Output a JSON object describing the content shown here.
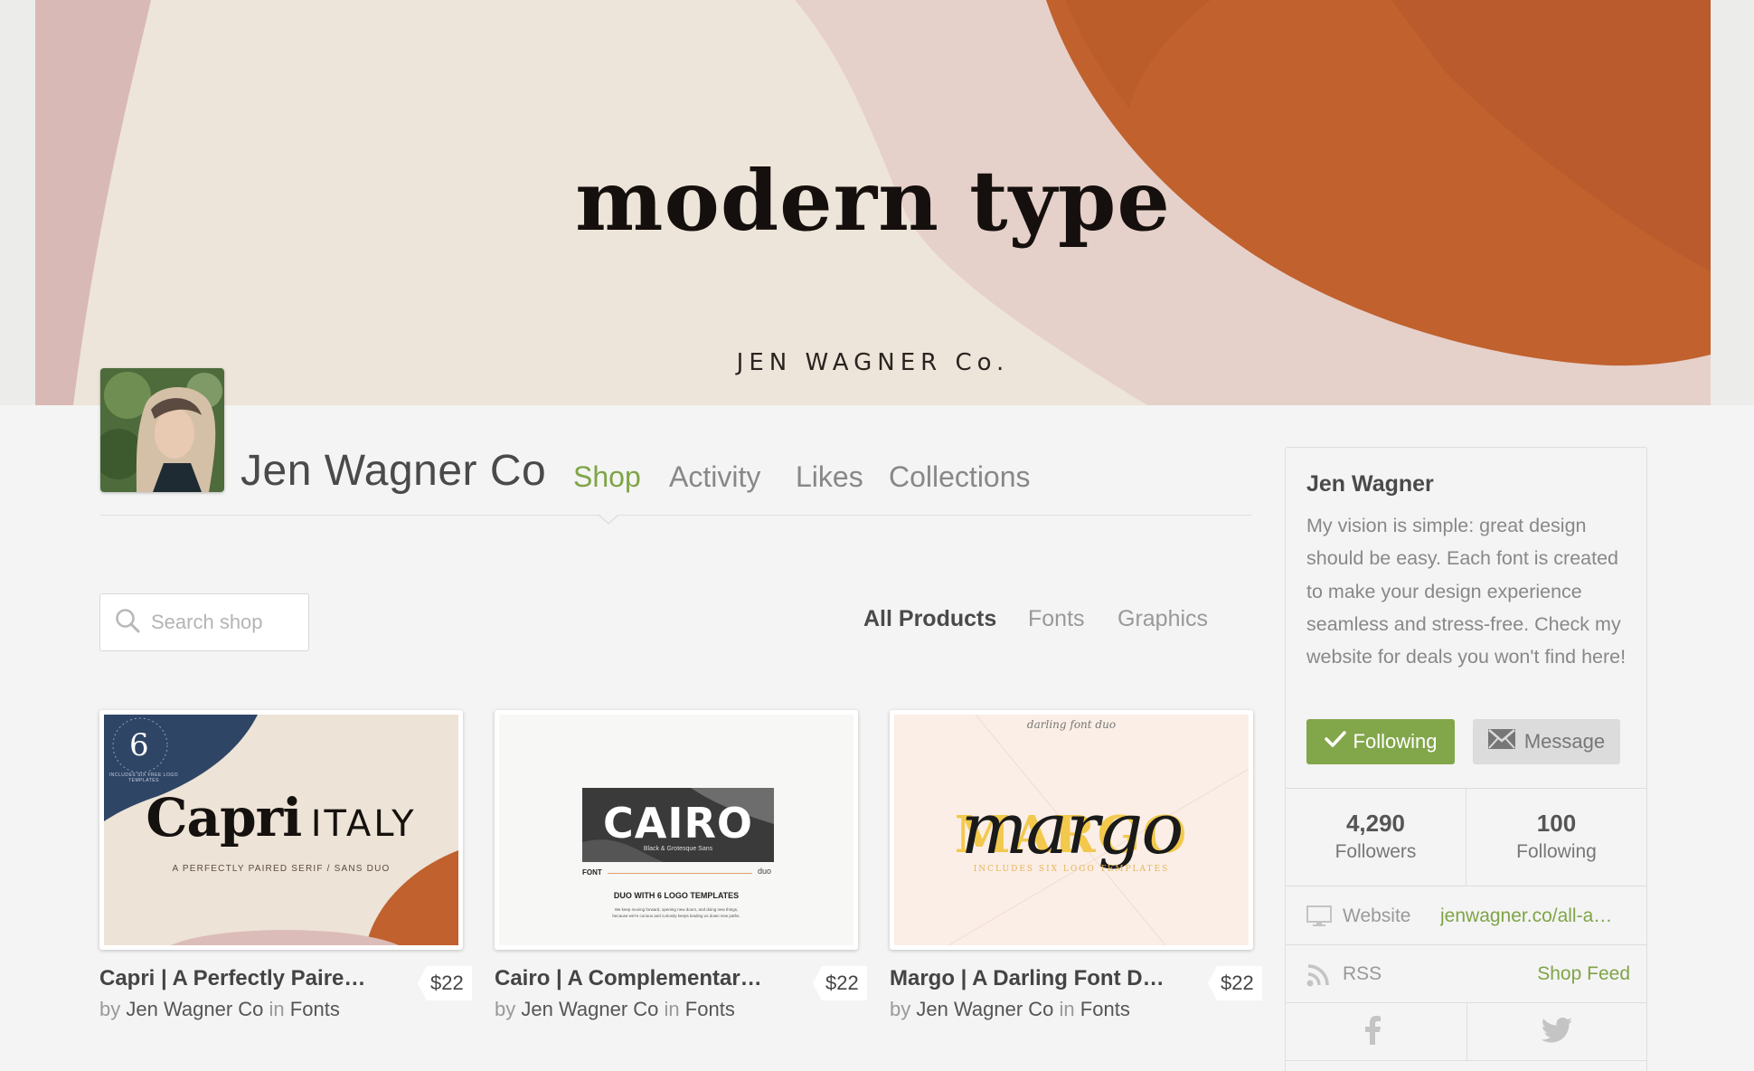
{
  "banner": {
    "title": "modern type",
    "subtitle": "JEN WAGNER Co."
  },
  "profile": {
    "shop_name": "Jen Wagner Co",
    "tabs": [
      {
        "label": "Shop",
        "active": true
      },
      {
        "label": "Activity",
        "active": false
      },
      {
        "label": "Likes",
        "active": false
      },
      {
        "label": "Collections",
        "active": false
      }
    ]
  },
  "search": {
    "placeholder": "Search shop",
    "icon": "search-icon"
  },
  "filters": [
    {
      "label": "All Products",
      "active": true
    },
    {
      "label": "Fonts",
      "active": false
    },
    {
      "label": "Graphics",
      "active": false
    }
  ],
  "products": [
    {
      "title": "Capri | A Perfectly Paire…",
      "price": "$22",
      "by_word": "by",
      "author": "Jen Wagner Co",
      "in_word": "in",
      "category": "Fonts",
      "thumb": {
        "badge_number": "6",
        "badge_ring": "INCLUDES SIX FREE LOGO TEMPLATES",
        "word": "Capri",
        "word2": "ITALY",
        "tagline": "A PERFECTLY PAIRED SERIF / SANS DUO"
      }
    },
    {
      "title": "Cairo | A Complementar…",
      "price": "$22",
      "by_word": "by",
      "author": "Jen Wagner Co",
      "in_word": "in",
      "category": "Fonts",
      "thumb": {
        "word": "CAIRO",
        "sub": "Black & Grotesque Sans",
        "left_tag": "FONT",
        "right_tag": "duo",
        "tagline": "DUO WITH 6 LOGO TEMPLATES",
        "fine1": "We keep moving forward, opening new doors, and doing new things,",
        "fine2": "because we're curious and curiosity keeps leading us down new paths."
      }
    },
    {
      "title": "Margo | A Darling Font D…",
      "price": "$22",
      "by_word": "by",
      "author": "Jen Wagner Co",
      "in_word": "in",
      "category": "Fonts",
      "thumb": {
        "script_top": "darling font duo",
        "word": "MARGO",
        "script": "margo",
        "tagline": "INCLUDES SIX LOGO TEMPLATES"
      }
    }
  ],
  "sidebar": {
    "name": "Jen Wagner",
    "bio": "My vision is simple: great design should be easy. Each font is created to make your design experience seamless and stress-free. Check my website for deals you won't find here!",
    "follow_label": "Following",
    "message_label": "Message",
    "followers_count": "4,290",
    "followers_label": "Followers",
    "following_count": "100",
    "following_label": "Following",
    "website_label": "Website",
    "website_value": "jenwagner.co/all-a…",
    "rss_label": "RSS",
    "rss_value": "Shop Feed"
  },
  "colors": {
    "accent": "#7fa447",
    "follow_button": "#82a64a",
    "banner_rust": "#c0612e",
    "banner_pink": "#dcc0bd",
    "banner_cream": "#ede5d9"
  }
}
